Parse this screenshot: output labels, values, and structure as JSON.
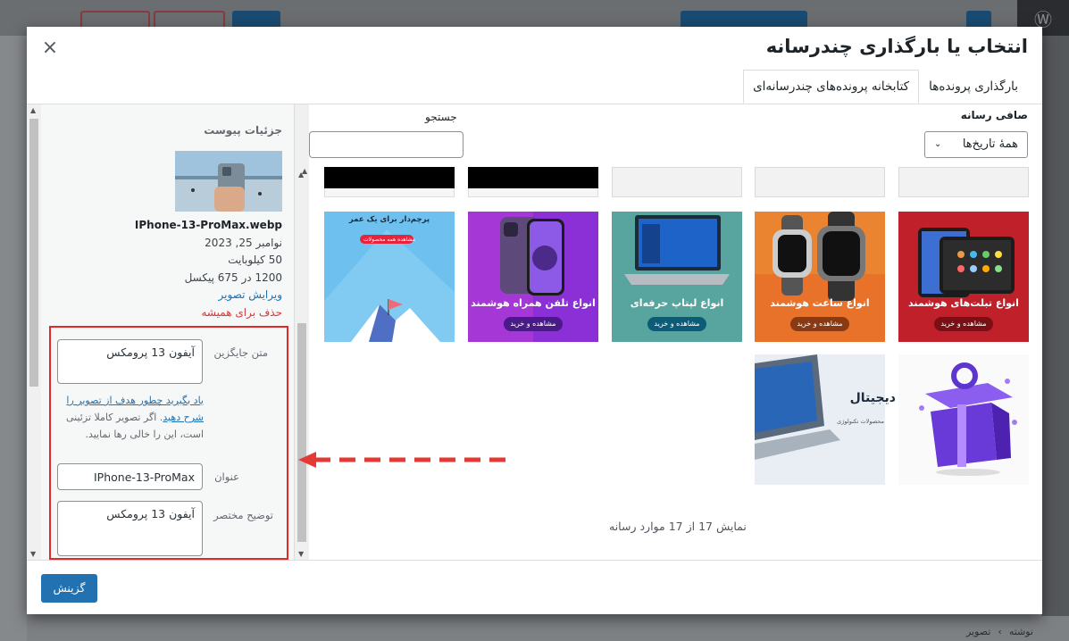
{
  "modal": {
    "title": "انتخاب یا بارگذاری چندرسانه",
    "close_icon": "×",
    "tabs": [
      {
        "label": "بارگذاری پرونده‌ها",
        "active": false
      },
      {
        "label": "کتابخانه پرونده‌های چندرسانه‌ای",
        "active": true
      }
    ]
  },
  "toolbar": {
    "filter_label": "صافی رسانه",
    "filter_value": "همهٔ تاریخ‌ها",
    "search_label": "جستجو",
    "search_value": ""
  },
  "attachment": {
    "heading": "جزئیات پیوست",
    "filename": "IPhone-13-ProMax.webp",
    "date": "نوامبر 25, 2023",
    "size": "50 کیلوبایت",
    "dimensions": "1200 در 675 پیکسل",
    "edit_link": "ویرایش تصویر",
    "delete_link": "حذف برای همیشه"
  },
  "fields": {
    "alt_label": "متن جایگزین",
    "alt_value": "آیفون 13 پرومکس",
    "help_link": "یاد بگیرید چطور هدف از تصویر را شرح دهید",
    "help_rest": ". اگر تصویر کاملا تزئینی است، این را خالی رها نمایید.",
    "title_label": "عنوان",
    "title_value": "IPhone-13-ProMax",
    "caption_label": "توضیح مختصر",
    "caption_value": "آیفون 13 پرومکس"
  },
  "grid": {
    "tiles": [
      {
        "name": "tablets",
        "title": "انواع تبلت‌های هوشمند",
        "cta": "مشاهده و خرید",
        "color": "#c0202a"
      },
      {
        "name": "smartwatch",
        "title": "انواع ساعت هوشمند",
        "cta": "مشاهده و خرید",
        "color": "#e8722a"
      },
      {
        "name": "laptop",
        "title": "انواع لپتاپ حرفه‌ای",
        "cta": "مشاهده و خرید",
        "color": "#1fa0c8"
      },
      {
        "name": "phone",
        "title": "انواع تلفن همراه هوشمند",
        "cta": "مشاهده و خرید",
        "color": "#8b2fd6"
      },
      {
        "name": "flag",
        "title": "پرچم‌دار برای یک عمر",
        "cta": "مشاهده همه محصولات",
        "color": "#5ab3e8"
      },
      {
        "name": "gift",
        "title": "",
        "cta": "",
        "color": "#ffffff"
      },
      {
        "name": "digital",
        "title": "دیجیتال",
        "sub": "محصولات تکنولوژی",
        "cta": "",
        "color": "#e8eef5"
      }
    ],
    "count_text": "نمایش 17 از 17 موارد رسانه"
  },
  "footer": {
    "select_label": "گزینش"
  },
  "background": {
    "breadcrumb": [
      "نوشته",
      "تصویر"
    ],
    "breadcrumb_sep": "›"
  }
}
